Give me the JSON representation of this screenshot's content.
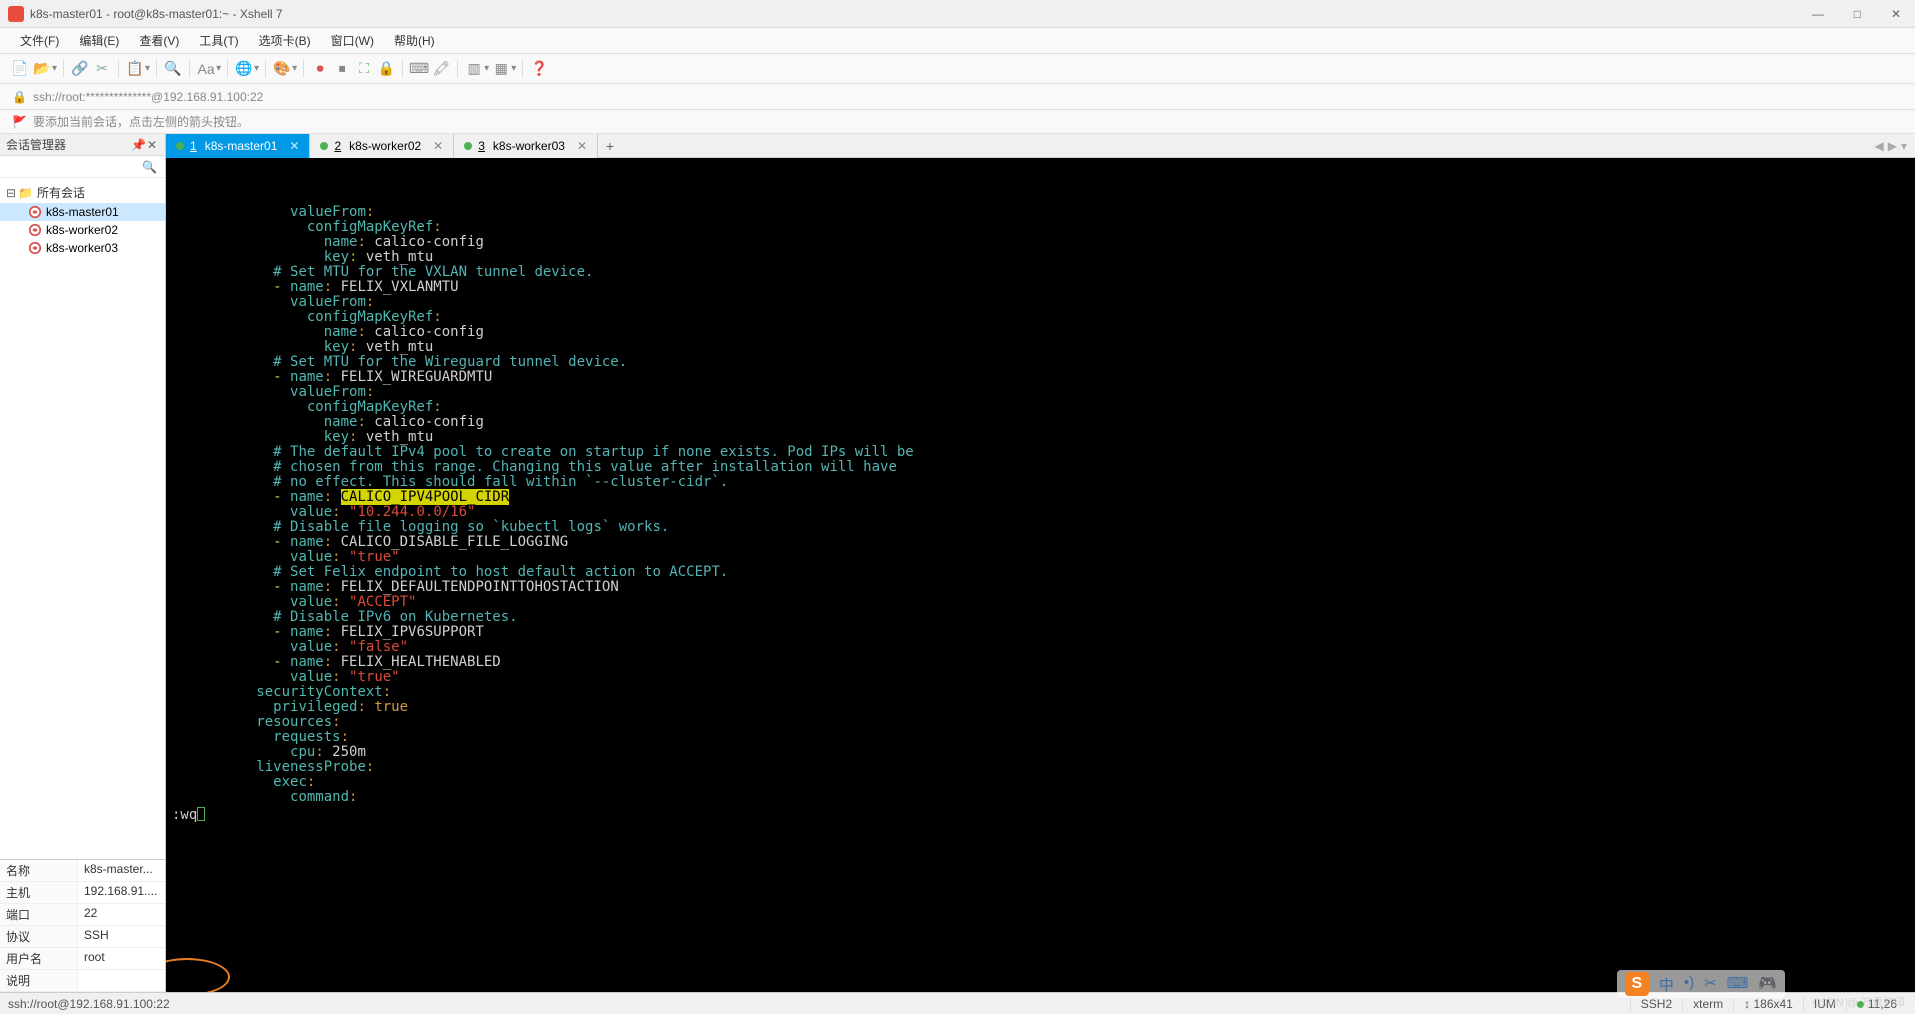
{
  "window": {
    "title": "k8s-master01 - root@k8s-master01:~ - Xshell 7",
    "minimize_label": "—",
    "maximize_label": "□",
    "close_label": "✕"
  },
  "menubar": {
    "items": [
      {
        "label": "文件",
        "accel": "(F)"
      },
      {
        "label": "编辑",
        "accel": "(E)"
      },
      {
        "label": "查看",
        "accel": "(V)"
      },
      {
        "label": "工具",
        "accel": "(T)"
      },
      {
        "label": "选项卡",
        "accel": "(B)"
      },
      {
        "label": "窗口",
        "accel": "(W)"
      },
      {
        "label": "帮助",
        "accel": "(H)"
      }
    ]
  },
  "toolbar": {
    "icons": [
      {
        "name": "new-session-icon",
        "glyph": "📄",
        "color": "#6fbf73"
      },
      {
        "name": "open-session-icon",
        "glyph": "📂",
        "color": "#d4a84b"
      },
      {
        "sep": true
      },
      {
        "name": "reconnect-icon",
        "glyph": "🔗",
        "color": "#8aa"
      },
      {
        "name": "disconnect-icon",
        "glyph": "✂",
        "color": "#8aa"
      },
      {
        "sep": true
      },
      {
        "name": "copy-icon",
        "glyph": "📋",
        "color": "#8aa"
      },
      {
        "sep": true
      },
      {
        "name": "search-icon",
        "glyph": "🔍",
        "color": "#888"
      },
      {
        "sep": true
      },
      {
        "name": "font-icon",
        "glyph": "Aa",
        "color": "#888"
      },
      {
        "sep": true
      },
      {
        "name": "globe-icon",
        "glyph": "🌐",
        "color": "#3b8686"
      },
      {
        "sep": true
      },
      {
        "name": "theme-icon",
        "glyph": "🎨",
        "color": "#888"
      },
      {
        "sep": true
      },
      {
        "name": "record-icon",
        "glyph": "⏺",
        "color": "#d9534f"
      },
      {
        "name": "stop-icon",
        "glyph": "⏹",
        "color": "#888"
      },
      {
        "name": "fullscreen-icon",
        "glyph": "⛶",
        "color": "#6fbf73"
      },
      {
        "name": "lock-toolbar-icon",
        "glyph": "🔒",
        "color": "#d4a84b"
      },
      {
        "sep": true
      },
      {
        "name": "keyboard-icon",
        "glyph": "⌨",
        "color": "#888"
      },
      {
        "name": "highlight-icon",
        "glyph": "🖍",
        "color": "#888"
      },
      {
        "sep": true
      },
      {
        "name": "layout-h-icon",
        "glyph": "▥",
        "color": "#888"
      },
      {
        "name": "layout-grid-icon",
        "glyph": "▦",
        "color": "#888"
      },
      {
        "sep": true
      },
      {
        "name": "help-icon",
        "glyph": "❓",
        "color": "#3b8686"
      }
    ]
  },
  "addressbar": {
    "text": "ssh://root:**************@192.168.91.100:22"
  },
  "hintbar": {
    "text": "要添加当前会话，点击左侧的箭头按钮。"
  },
  "session_panel": {
    "title": "会话管理器",
    "root_label": "所有会话",
    "sessions": [
      {
        "label": "k8s-master01",
        "active": true
      },
      {
        "label": "k8s-worker02",
        "active": false
      },
      {
        "label": "k8s-worker03",
        "active": false
      }
    ],
    "props": [
      {
        "label": "名称",
        "value": "k8s-master..."
      },
      {
        "label": "主机",
        "value": "192.168.91...."
      },
      {
        "label": "端口",
        "value": "22"
      },
      {
        "label": "协议",
        "value": "SSH"
      },
      {
        "label": "用户名",
        "value": "root"
      },
      {
        "label": "说明",
        "value": ""
      }
    ]
  },
  "tabs": {
    "items": [
      {
        "num": "1",
        "label": "k8s-master01",
        "active": true
      },
      {
        "num": "2",
        "label": "k8s-worker02",
        "active": false
      },
      {
        "num": "3",
        "label": "k8s-worker03",
        "active": false
      }
    ]
  },
  "terminal": {
    "lines": [
      {
        "i": "              ",
        "t": [
          {
            "c": "teal",
            "s": "valueFrom"
          },
          {
            "c": "orange",
            "s": ":"
          }
        ]
      },
      {
        "i": "                ",
        "t": [
          {
            "c": "teal",
            "s": "configMapKeyRef"
          },
          {
            "c": "orange",
            "s": ":"
          }
        ]
      },
      {
        "i": "                  ",
        "t": [
          {
            "c": "teal",
            "s": "name"
          },
          {
            "c": "orange",
            "s": ": "
          },
          {
            "c": "white",
            "s": "calico-config"
          }
        ]
      },
      {
        "i": "                  ",
        "t": [
          {
            "c": "teal",
            "s": "key"
          },
          {
            "c": "orange",
            "s": ": "
          },
          {
            "c": "white",
            "s": "veth_mtu"
          }
        ]
      },
      {
        "i": "            ",
        "t": [
          {
            "c": "cyan",
            "s": "# Set MTU for the VXLAN tunnel device."
          }
        ]
      },
      {
        "i": "            ",
        "t": [
          {
            "c": "yellow",
            "s": "- "
          },
          {
            "c": "teal",
            "s": "name"
          },
          {
            "c": "orange",
            "s": ": "
          },
          {
            "c": "white",
            "s": "FELIX_VXLANMTU"
          }
        ]
      },
      {
        "i": "              ",
        "t": [
          {
            "c": "teal",
            "s": "valueFrom"
          },
          {
            "c": "orange",
            "s": ":"
          }
        ]
      },
      {
        "i": "                ",
        "t": [
          {
            "c": "teal",
            "s": "configMapKeyRef"
          },
          {
            "c": "orange",
            "s": ":"
          }
        ]
      },
      {
        "i": "                  ",
        "t": [
          {
            "c": "teal",
            "s": "name"
          },
          {
            "c": "orange",
            "s": ": "
          },
          {
            "c": "white",
            "s": "calico-config"
          }
        ]
      },
      {
        "i": "                  ",
        "t": [
          {
            "c": "teal",
            "s": "key"
          },
          {
            "c": "orange",
            "s": ": "
          },
          {
            "c": "white",
            "s": "veth_mtu"
          }
        ]
      },
      {
        "i": "            ",
        "t": [
          {
            "c": "cyan",
            "s": "# Set MTU for the Wireguard tunnel device."
          }
        ]
      },
      {
        "i": "            ",
        "t": [
          {
            "c": "yellow",
            "s": "- "
          },
          {
            "c": "teal",
            "s": "name"
          },
          {
            "c": "orange",
            "s": ": "
          },
          {
            "c": "white",
            "s": "FELIX_WIREGUARDMTU"
          }
        ]
      },
      {
        "i": "              ",
        "t": [
          {
            "c": "teal",
            "s": "valueFrom"
          },
          {
            "c": "orange",
            "s": ":"
          }
        ]
      },
      {
        "i": "                ",
        "t": [
          {
            "c": "teal",
            "s": "configMapKeyRef"
          },
          {
            "c": "orange",
            "s": ":"
          }
        ]
      },
      {
        "i": "                  ",
        "t": [
          {
            "c": "teal",
            "s": "name"
          },
          {
            "c": "orange",
            "s": ": "
          },
          {
            "c": "white",
            "s": "calico-config"
          }
        ]
      },
      {
        "i": "                  ",
        "t": [
          {
            "c": "teal",
            "s": "key"
          },
          {
            "c": "orange",
            "s": ": "
          },
          {
            "c": "white",
            "s": "veth_mtu"
          }
        ]
      },
      {
        "i": "            ",
        "t": [
          {
            "c": "cyan",
            "s": "# The default IPv4 pool to create on startup if none exists. Pod IPs will be"
          }
        ]
      },
      {
        "i": "            ",
        "t": [
          {
            "c": "cyan",
            "s": "# chosen from this range. Changing this value after installation will have"
          }
        ]
      },
      {
        "i": "            ",
        "t": [
          {
            "c": "cyan",
            "s": "# no effect. This should fall within `--cluster-cidr`."
          }
        ]
      },
      {
        "i": "            ",
        "t": [
          {
            "c": "yellow",
            "s": "- "
          },
          {
            "c": "teal",
            "s": "name"
          },
          {
            "c": "orange",
            "s": ": "
          },
          {
            "hl": true,
            "s": "CALICO_IPV4POOL_CIDR"
          }
        ]
      },
      {
        "i": "              ",
        "t": [
          {
            "c": "teal",
            "s": "value"
          },
          {
            "c": "orange",
            "s": ": "
          },
          {
            "c": "red",
            "s": "\"10.244.0.0/16\""
          }
        ]
      },
      {
        "i": "            ",
        "t": [
          {
            "c": "cyan",
            "s": "# Disable file logging so `kubectl logs` works."
          }
        ]
      },
      {
        "i": "            ",
        "t": [
          {
            "c": "yellow",
            "s": "- "
          },
          {
            "c": "teal",
            "s": "name"
          },
          {
            "c": "orange",
            "s": ": "
          },
          {
            "c": "white",
            "s": "CALICO_DISABLE_FILE_LOGGING"
          }
        ]
      },
      {
        "i": "              ",
        "t": [
          {
            "c": "teal",
            "s": "value"
          },
          {
            "c": "orange",
            "s": ": "
          },
          {
            "c": "red",
            "s": "\"true\""
          }
        ]
      },
      {
        "i": "            ",
        "t": [
          {
            "c": "cyan",
            "s": "# Set Felix endpoint to host default action to ACCEPT."
          }
        ]
      },
      {
        "i": "            ",
        "t": [
          {
            "c": "yellow",
            "s": "- "
          },
          {
            "c": "teal",
            "s": "name"
          },
          {
            "c": "orange",
            "s": ": "
          },
          {
            "c": "white",
            "s": "FELIX_DEFAULTENDPOINTTOHOSTACTION"
          }
        ]
      },
      {
        "i": "              ",
        "t": [
          {
            "c": "teal",
            "s": "value"
          },
          {
            "c": "orange",
            "s": ": "
          },
          {
            "c": "red",
            "s": "\"ACCEPT\""
          }
        ]
      },
      {
        "i": "            ",
        "t": [
          {
            "c": "cyan",
            "s": "# Disable IPv6 on Kubernetes."
          }
        ]
      },
      {
        "i": "            ",
        "t": [
          {
            "c": "yellow",
            "s": "- "
          },
          {
            "c": "teal",
            "s": "name"
          },
          {
            "c": "orange",
            "s": ": "
          },
          {
            "c": "white",
            "s": "FELIX_IPV6SUPPORT"
          }
        ]
      },
      {
        "i": "              ",
        "t": [
          {
            "c": "teal",
            "s": "value"
          },
          {
            "c": "orange",
            "s": ": "
          },
          {
            "c": "red",
            "s": "\"false\""
          }
        ]
      },
      {
        "i": "            ",
        "t": [
          {
            "c": "yellow",
            "s": "- "
          },
          {
            "c": "teal",
            "s": "name"
          },
          {
            "c": "orange",
            "s": ": "
          },
          {
            "c": "white",
            "s": "FELIX_HEALTHENABLED"
          }
        ]
      },
      {
        "i": "              ",
        "t": [
          {
            "c": "teal",
            "s": "value"
          },
          {
            "c": "orange",
            "s": ": "
          },
          {
            "c": "red",
            "s": "\"true\""
          }
        ]
      },
      {
        "i": "          ",
        "t": [
          {
            "c": "teal",
            "s": "securityContext"
          },
          {
            "c": "orange",
            "s": ":"
          }
        ]
      },
      {
        "i": "            ",
        "t": [
          {
            "c": "teal",
            "s": "privileged"
          },
          {
            "c": "orange",
            "s": ": "
          },
          {
            "c": "orange",
            "s": "true"
          }
        ]
      },
      {
        "i": "          ",
        "t": [
          {
            "c": "teal",
            "s": "resources"
          },
          {
            "c": "orange",
            "s": ":"
          }
        ]
      },
      {
        "i": "            ",
        "t": [
          {
            "c": "teal",
            "s": "requests"
          },
          {
            "c": "orange",
            "s": ":"
          }
        ]
      },
      {
        "i": "              ",
        "t": [
          {
            "c": "teal",
            "s": "cpu"
          },
          {
            "c": "orange",
            "s": ": "
          },
          {
            "c": "white",
            "s": "250m"
          }
        ]
      },
      {
        "i": "          ",
        "t": [
          {
            "c": "teal",
            "s": "livenessProbe"
          },
          {
            "c": "orange",
            "s": ":"
          }
        ]
      },
      {
        "i": "            ",
        "t": [
          {
            "c": "teal",
            "s": "exec"
          },
          {
            "c": "orange",
            "s": ":"
          }
        ]
      },
      {
        "i": "              ",
        "t": [
          {
            "c": "teal",
            "s": "command"
          },
          {
            "c": "orange",
            "s": ":"
          }
        ]
      }
    ],
    "cmdline": ":wq"
  },
  "statusbar": {
    "left": "ssh://root@192.168.91.100:22",
    "items": [
      "SSH2",
      "xterm",
      "↕ 186x41",
      "IUM"
    ],
    "caps": "11,26"
  },
  "ime": {
    "items": [
      "中",
      "•)",
      "✂",
      "⌨",
      "🎮"
    ]
  },
  "watermark": "CSDN @ 万票打印"
}
